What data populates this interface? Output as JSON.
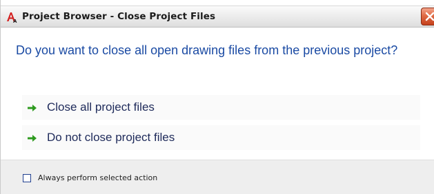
{
  "window": {
    "title": "Project Browser - Close Project Files",
    "app_icon": "autocad-letter-a-icon",
    "close_icon": "close-x-icon"
  },
  "prompt": {
    "question": "Do you want to close all open drawing files from the previous project?"
  },
  "options": [
    {
      "label": "Close all project files",
      "icon": "green-arrow-icon"
    },
    {
      "label": "Do not close project files",
      "icon": "green-arrow-icon"
    }
  ],
  "footer": {
    "checkbox_label": "Always perform selected action",
    "checkbox_checked": false
  },
  "colors": {
    "question_text": "#1a4aa3",
    "option_text": "#1e2a5a",
    "arrow": "#2e9a1f",
    "close_button": "#e06b45"
  }
}
